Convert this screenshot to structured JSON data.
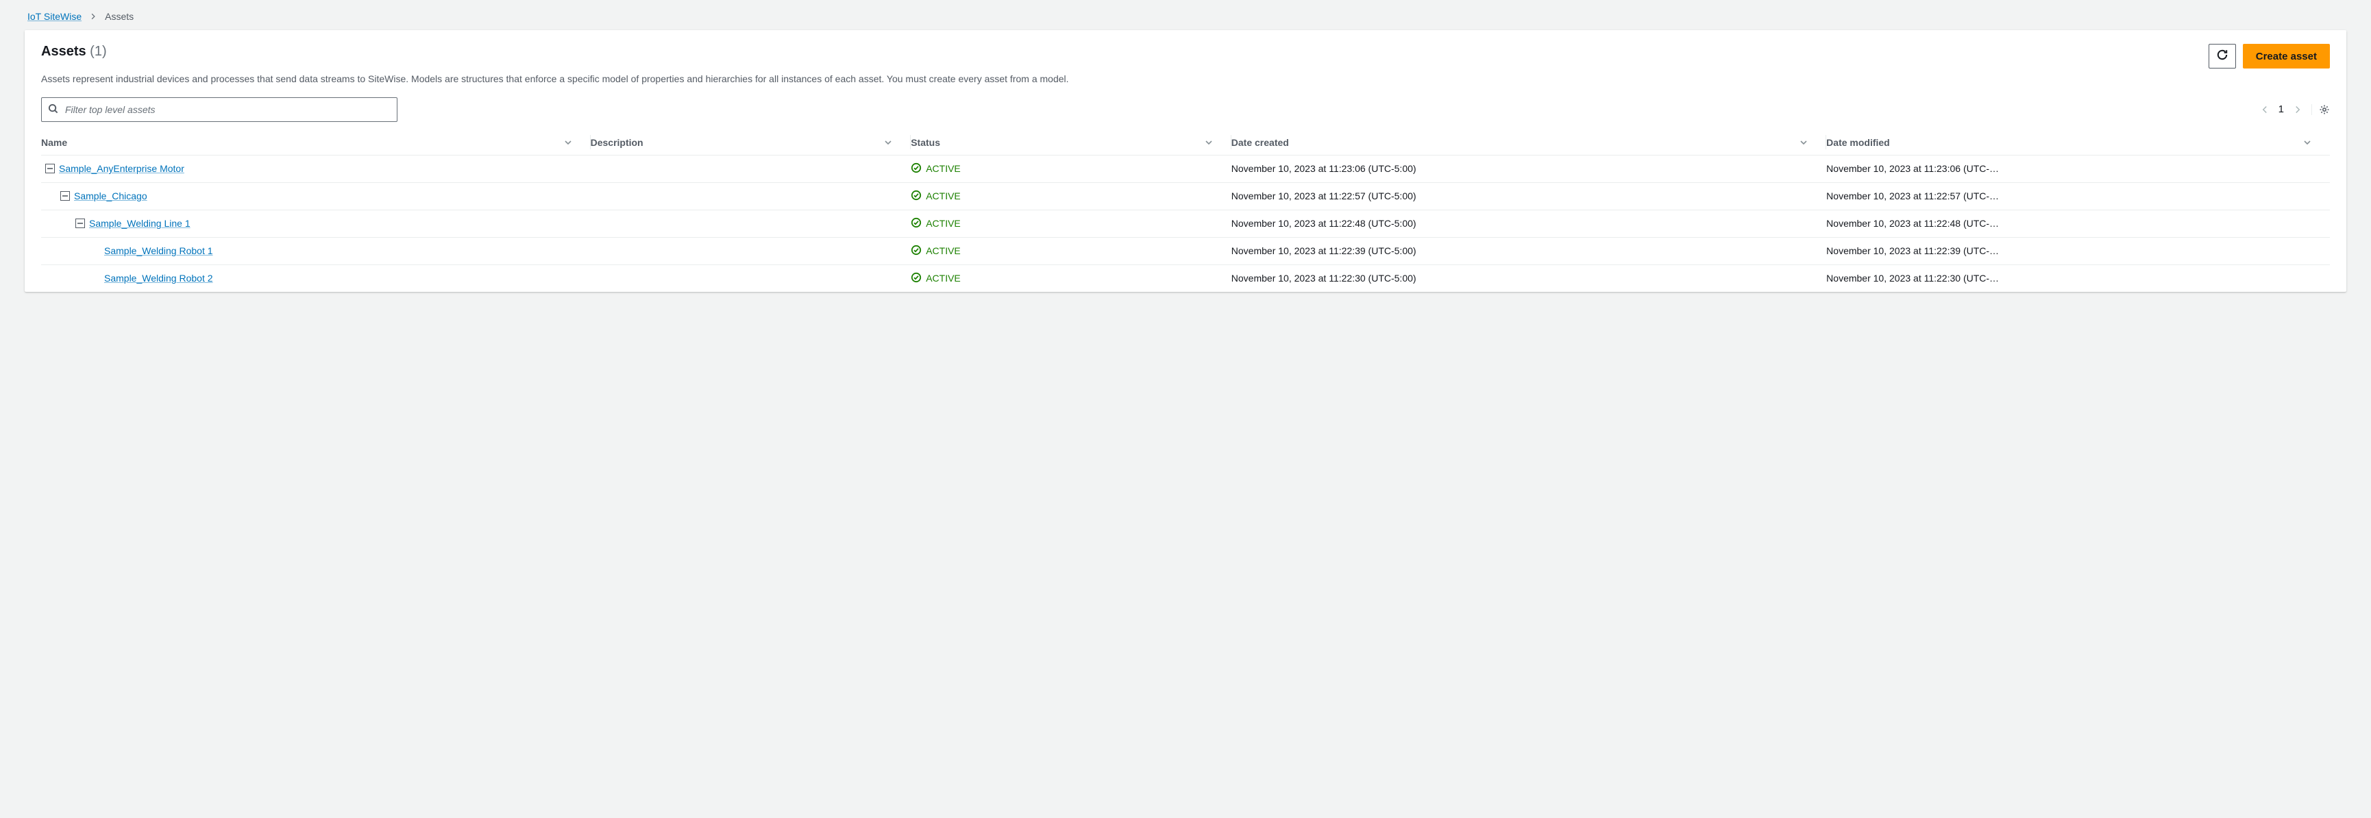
{
  "breadcrumb": {
    "root": "IoT SiteWise",
    "current": "Assets"
  },
  "header": {
    "title": "Assets",
    "count": "(1)",
    "description": "Assets represent industrial devices and processes that send data streams to SiteWise. Models are structures that enforce a specific model of properties and hierarchies for all instances of each asset. You must create every asset from a model.",
    "create_label": "Create asset"
  },
  "filter": {
    "placeholder": "Filter top level assets"
  },
  "pagination": {
    "page": "1"
  },
  "columns": {
    "name": "Name",
    "description": "Description",
    "status": "Status",
    "created": "Date created",
    "modified": "Date modified"
  },
  "rows": [
    {
      "depth": 0,
      "expandable": true,
      "name": "Sample_AnyEnterprise Motor",
      "description": "",
      "status": "ACTIVE",
      "created": "November 10, 2023 at 11:23:06 (UTC-5:00)",
      "modified": "November 10, 2023 at 11:23:06 (UTC-…"
    },
    {
      "depth": 1,
      "expandable": true,
      "name": "Sample_Chicago",
      "description": "",
      "status": "ACTIVE",
      "created": "November 10, 2023 at 11:22:57 (UTC-5:00)",
      "modified": "November 10, 2023 at 11:22:57 (UTC-…"
    },
    {
      "depth": 2,
      "expandable": true,
      "name": "Sample_Welding Line 1",
      "description": "",
      "status": "ACTIVE",
      "created": "November 10, 2023 at 11:22:48 (UTC-5:00)",
      "modified": "November 10, 2023 at 11:22:48 (UTC-…"
    },
    {
      "depth": 3,
      "expandable": false,
      "name": "Sample_Welding Robot 1",
      "description": "",
      "status": "ACTIVE",
      "created": "November 10, 2023 at 11:22:39 (UTC-5:00)",
      "modified": "November 10, 2023 at 11:22:39 (UTC-…"
    },
    {
      "depth": 3,
      "expandable": false,
      "name": "Sample_Welding Robot 2",
      "description": "",
      "status": "ACTIVE",
      "created": "November 10, 2023 at 11:22:30 (UTC-5:00)",
      "modified": "November 10, 2023 at 11:22:30 (UTC-…"
    }
  ]
}
